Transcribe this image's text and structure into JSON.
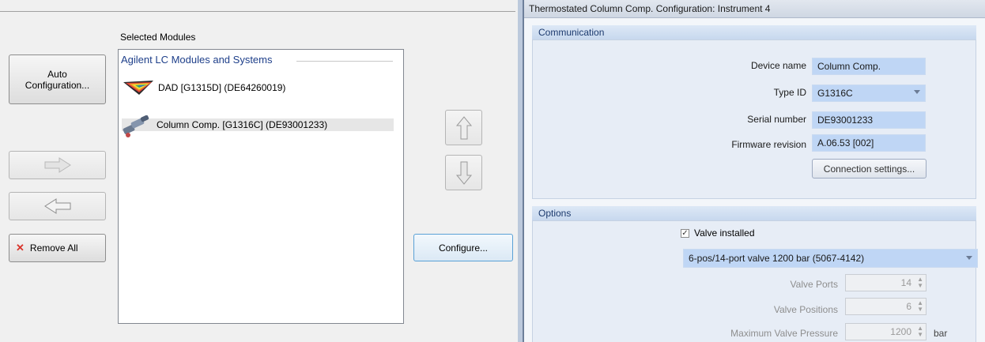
{
  "left": {
    "selected_modules_label": "Selected Modules",
    "auto_config_label": "Auto\nConfiguration...",
    "add_arrow_icon": "arrow-right",
    "remove_arrow_icon": "arrow-left",
    "remove_all_label": "Remove All",
    "remove_all_icon": "x",
    "configure_label": "Configure...",
    "move_up_icon": "arrow-up",
    "move_down_icon": "arrow-down",
    "group_title": "Agilent LC Modules and Systems",
    "modules": [
      {
        "label": "DAD [G1315D] (DE64260019)",
        "icon": "dad-prism-icon",
        "selected": false
      },
      {
        "label": "Column Comp. [G1316C] (DE93001233)",
        "icon": "column-comp-icon",
        "selected": true
      }
    ]
  },
  "panel": {
    "title": "Thermostated Column Comp. Configuration: Instrument 4",
    "communication": {
      "header": "Communication",
      "device_name_label": "Device name",
      "device_name_value": "Column Comp.",
      "type_id_label": "Type ID",
      "type_id_value": "G1316C",
      "serial_label": "Serial number",
      "serial_value": "DE93001233",
      "firmware_label": "Firmware revision",
      "firmware_value": "A.06.53 [002]",
      "connection_settings_label": "Connection settings..."
    },
    "options": {
      "header": "Options",
      "valve_installed_label": "Valve installed",
      "valve_installed_checked": true,
      "valve_type_value": "6-pos/14-port valve 1200 bar (5067-4142)",
      "valve_ports_label": "Valve Ports",
      "valve_ports_value": "14",
      "valve_positions_label": "Valve Positions",
      "valve_positions_value": "6",
      "max_pressure_label": "Maximum Valve Pressure",
      "max_pressure_value": "1200",
      "max_pressure_unit": "bar"
    }
  },
  "colors": {
    "field_bg": "#bfd6f5",
    "section_bg": "#e7edf6",
    "group_title": "#1e3f8a",
    "remove_icon": "#d9342b"
  }
}
